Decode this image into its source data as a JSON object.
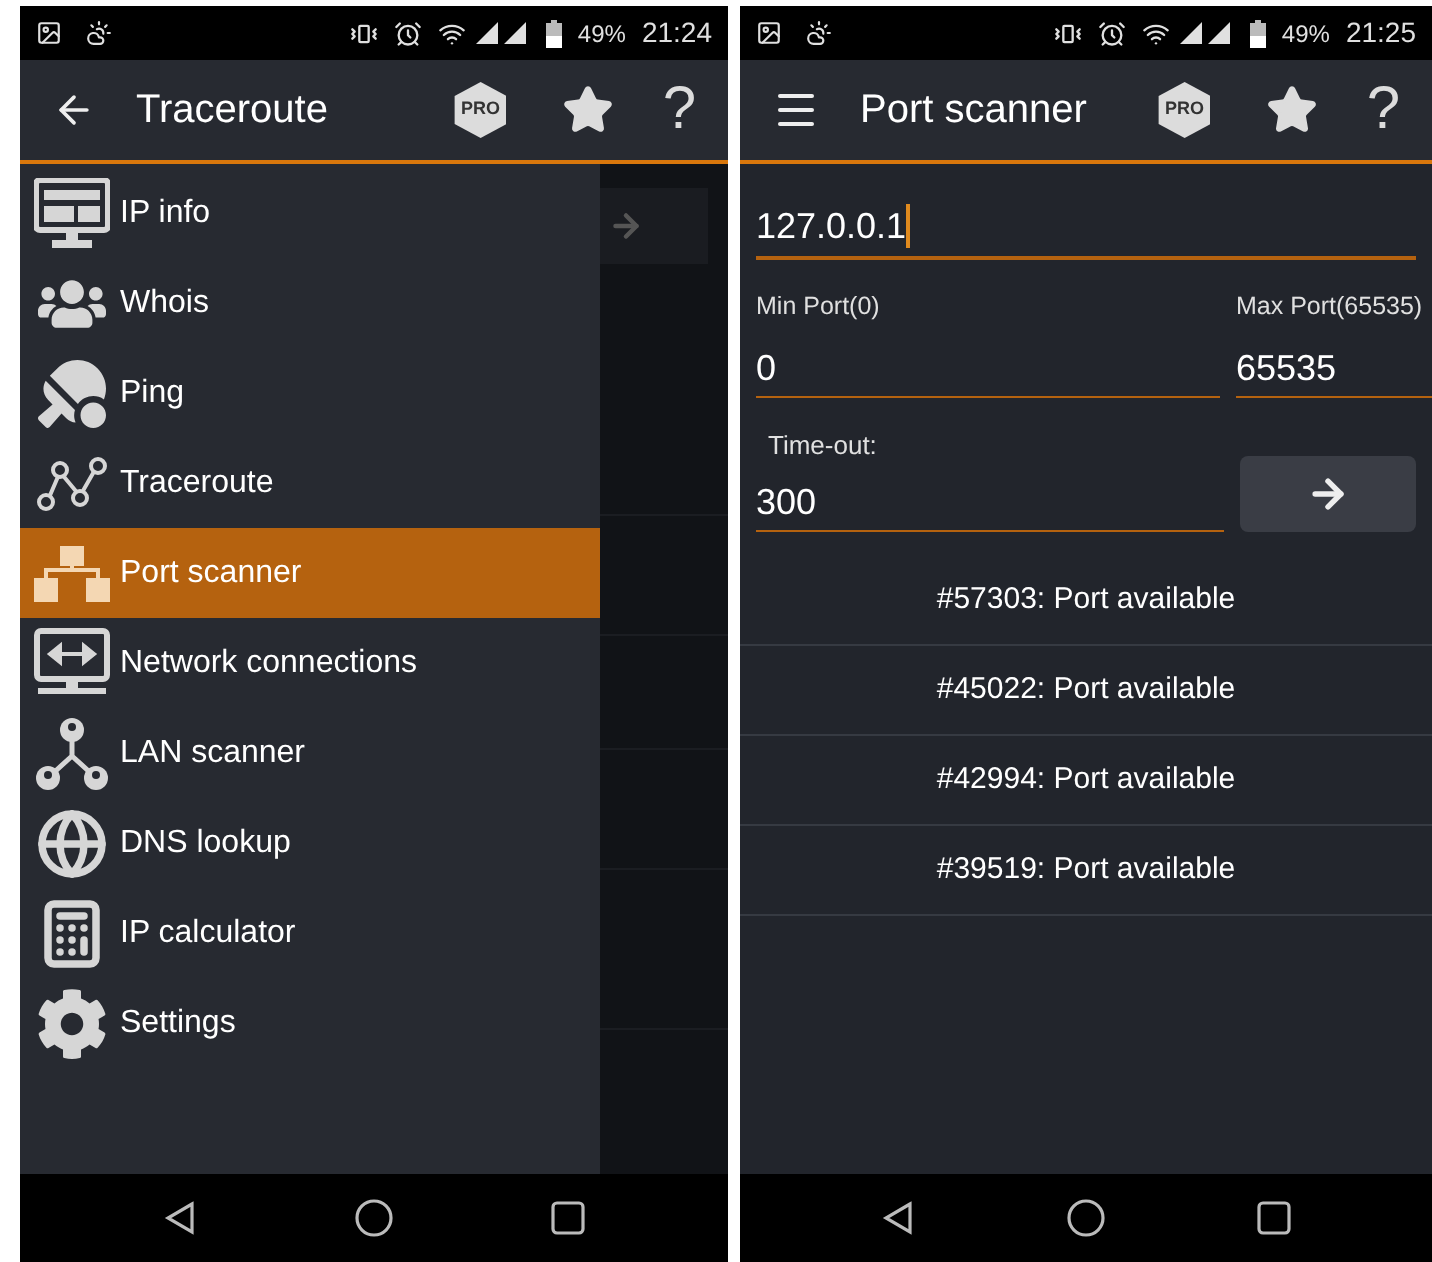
{
  "screens": [
    {
      "status_bar": {
        "battery": "49%",
        "time": "21:24"
      },
      "app_bar": {
        "nav": {
          "kind": "back"
        },
        "title": "Traceroute",
        "badge": "PRO",
        "help": "?"
      },
      "drawer": {
        "items": [
          {
            "label": "IP info",
            "selected": false
          },
          {
            "label": "Whois",
            "selected": false
          },
          {
            "label": "Ping",
            "selected": false
          },
          {
            "label": "Traceroute",
            "selected": false
          },
          {
            "label": "Port scanner",
            "selected": true
          },
          {
            "label": "Network connections",
            "selected": false
          },
          {
            "label": "LAN scanner",
            "selected": false
          },
          {
            "label": "DNS lookup",
            "selected": false
          },
          {
            "label": "IP calculator",
            "selected": false
          },
          {
            "label": "Settings",
            "selected": false
          }
        ]
      }
    },
    {
      "status_bar": {
        "battery": "49%",
        "time": "21:25"
      },
      "app_bar": {
        "nav": {
          "kind": "menu"
        },
        "title": "Port scanner",
        "badge": "PRO",
        "help": "?"
      },
      "form": {
        "host": {
          "value": "127.0.0.1",
          "focused": true
        },
        "min_port": {
          "label": "Min Port(0)",
          "value": "0"
        },
        "max_port": {
          "label": "Max Port(65535)",
          "value": "65535"
        },
        "timeout": {
          "label": "Time-out:",
          "value": "300"
        }
      },
      "results": [
        "#57303: Port available",
        "#45022: Port available",
        "#42994: Port available",
        "#39519: Port available"
      ]
    }
  ]
}
